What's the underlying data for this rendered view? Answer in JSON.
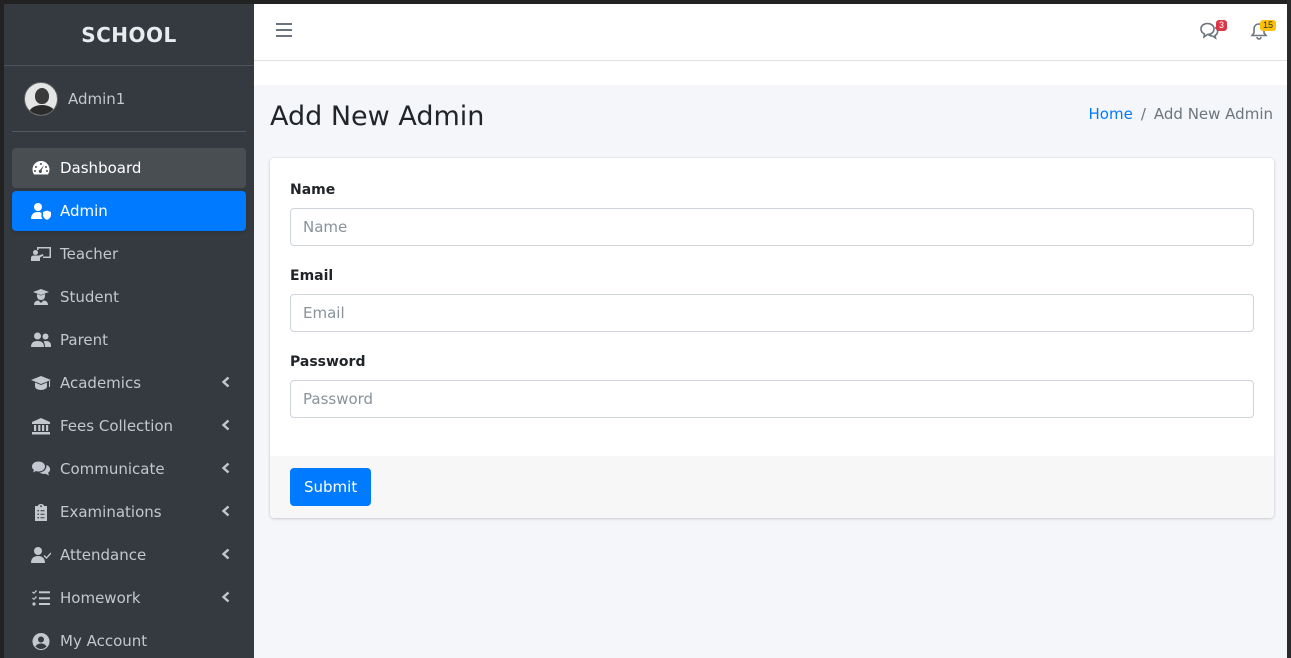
{
  "brand": {
    "name": "SCHOOL"
  },
  "user": {
    "name": "Admin1"
  },
  "sidebar": {
    "items": [
      {
        "label": "Dashboard",
        "icon": "tachometer-icon",
        "state": "hover",
        "has_arrow": false
      },
      {
        "label": "Admin",
        "icon": "user-shield-icon",
        "state": "active",
        "has_arrow": false
      },
      {
        "label": "Teacher",
        "icon": "chalkboard-teacher-icon",
        "state": "",
        "has_arrow": false
      },
      {
        "label": "Student",
        "icon": "user-graduate-icon",
        "state": "",
        "has_arrow": false
      },
      {
        "label": "Parent",
        "icon": "user-friends-icon",
        "state": "",
        "has_arrow": false
      },
      {
        "label": "Academics",
        "icon": "graduation-cap-icon",
        "state": "",
        "has_arrow": true
      },
      {
        "label": "Fees Collection",
        "icon": "university-icon",
        "state": "",
        "has_arrow": true
      },
      {
        "label": "Communicate",
        "icon": "comments-icon",
        "state": "",
        "has_arrow": true
      },
      {
        "label": "Examinations",
        "icon": "clipboard-list-icon",
        "state": "",
        "has_arrow": true
      },
      {
        "label": "Attendance",
        "icon": "user-check-icon",
        "state": "",
        "has_arrow": true
      },
      {
        "label": "Homework",
        "icon": "tasks-icon",
        "state": "",
        "has_arrow": true
      },
      {
        "label": "My Account",
        "icon": "user-circle-icon",
        "state": "",
        "has_arrow": false
      }
    ]
  },
  "navbar": {
    "messages_badge": "3",
    "notifications_badge": "15"
  },
  "header": {
    "title": "Add New Admin",
    "breadcrumb_home": "Home",
    "breadcrumb_separator": "/",
    "breadcrumb_current": "Add New Admin"
  },
  "form": {
    "name_label": "Name",
    "name_placeholder": "Name",
    "email_label": "Email",
    "email_placeholder": "Email",
    "password_label": "Password",
    "password_placeholder": "Password",
    "submit_label": "Submit"
  },
  "colors": {
    "accent": "#007bff",
    "sidebar_bg": "#343a40",
    "badge_danger": "#dc3545",
    "badge_warning": "#ffc107"
  }
}
